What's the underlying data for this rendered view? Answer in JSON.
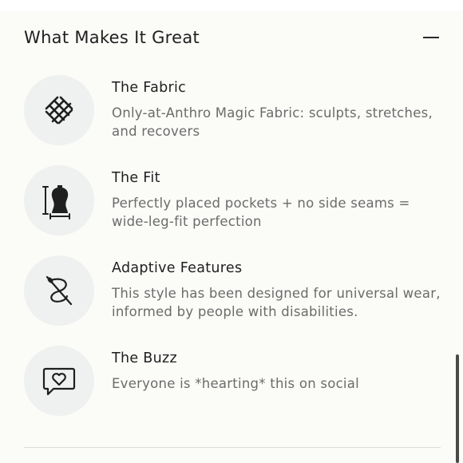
{
  "accordion": {
    "title": "What Makes It Great",
    "collapse_icon": "minus-icon"
  },
  "features": [
    {
      "title": "The Fabric",
      "description": "Only-at-Anthro Magic Fabric: sculpts, stretches, and recovers",
      "icon": "woven-fabric-icon"
    },
    {
      "title": "The Fit",
      "description": "Perfectly placed pockets + no side seams = wide-leg-fit perfection",
      "icon": "dress-form-icon"
    },
    {
      "title": "Adaptive Features",
      "description": "This style has been designed for universal wear, informed by people with disabilities.",
      "icon": "needle-thread-icon"
    },
    {
      "title": "The Buzz",
      "description": "Everyone is *hearting* this on social",
      "icon": "heart-chat-icon"
    }
  ],
  "colors": {
    "background": "#fbfbf8",
    "icon_circle": "#eef1f0",
    "title_text": "#1f1f1f",
    "description_text": "#6b6b6b"
  }
}
